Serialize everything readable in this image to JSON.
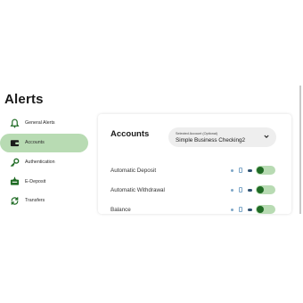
{
  "page": {
    "title": "Alerts"
  },
  "sidebar": {
    "items": [
      {
        "label": "General Alerts",
        "icon": "bell-icon",
        "selected": false
      },
      {
        "label": "Accounts",
        "icon": "wallet-icon",
        "selected": true
      },
      {
        "label": "Authentication",
        "icon": "key-icon",
        "selected": false
      },
      {
        "label": "E-Deposit",
        "icon": "deposit-icon",
        "selected": false
      },
      {
        "label": "Transfers",
        "icon": "transfer-icon",
        "selected": false
      }
    ]
  },
  "accounts": {
    "title": "Accounts",
    "select": {
      "caption": "Selected Account (Optional)",
      "value": "Simple Business Checking2"
    },
    "alerts": [
      {
        "label": "Automatic Deposit",
        "enabled": true
      },
      {
        "label": "Automatic Withdrawal",
        "enabled": true
      },
      {
        "label": "Balance",
        "enabled": true
      }
    ]
  },
  "colors": {
    "accent": "#1f6b24",
    "accent_light": "#b8dbb3",
    "channel_icon": "#7da6c7",
    "channel_icon_dark": "#2f5170"
  }
}
